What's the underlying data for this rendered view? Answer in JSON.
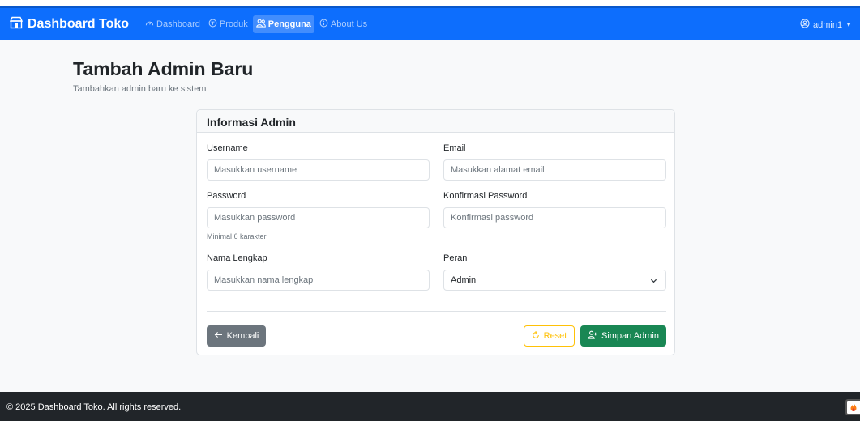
{
  "navbar": {
    "brand": "Dashboard Toko",
    "links": [
      {
        "label": "Dashboard",
        "icon": "speedometer-icon"
      },
      {
        "label": "Produk",
        "icon": "box-icon"
      },
      {
        "label": "Pengguna",
        "icon": "people-icon",
        "active": true
      },
      {
        "label": "About Us",
        "icon": "info-circle-icon"
      }
    ],
    "user": "admin1"
  },
  "page": {
    "title": "Tambah Admin Baru",
    "subtitle": "Tambahkan admin baru ke sistem"
  },
  "form": {
    "header": "Informasi Admin",
    "username": {
      "label": "Username",
      "placeholder": "Masukkan username"
    },
    "email": {
      "label": "Email",
      "placeholder": "Masukkan alamat email"
    },
    "password": {
      "label": "Password",
      "placeholder": "Masukkan password",
      "help": "Minimal 6 karakter"
    },
    "confirm_password": {
      "label": "Konfirmasi Password",
      "placeholder": "Konfirmasi password"
    },
    "full_name": {
      "label": "Nama Lengkap",
      "placeholder": "Masukkan nama lengkap"
    },
    "role": {
      "label": "Peran",
      "value": "Admin"
    },
    "buttons": {
      "back": "Kembali",
      "reset": "Reset",
      "save": "Simpan Admin"
    }
  },
  "footer": {
    "text": "© 2025 Dashboard Toko. All rights reserved."
  },
  "colors": {
    "primary": "#0d6efd",
    "secondary": "#6c757d",
    "warning": "#ffc107",
    "success": "#198754",
    "dark": "#212529"
  }
}
